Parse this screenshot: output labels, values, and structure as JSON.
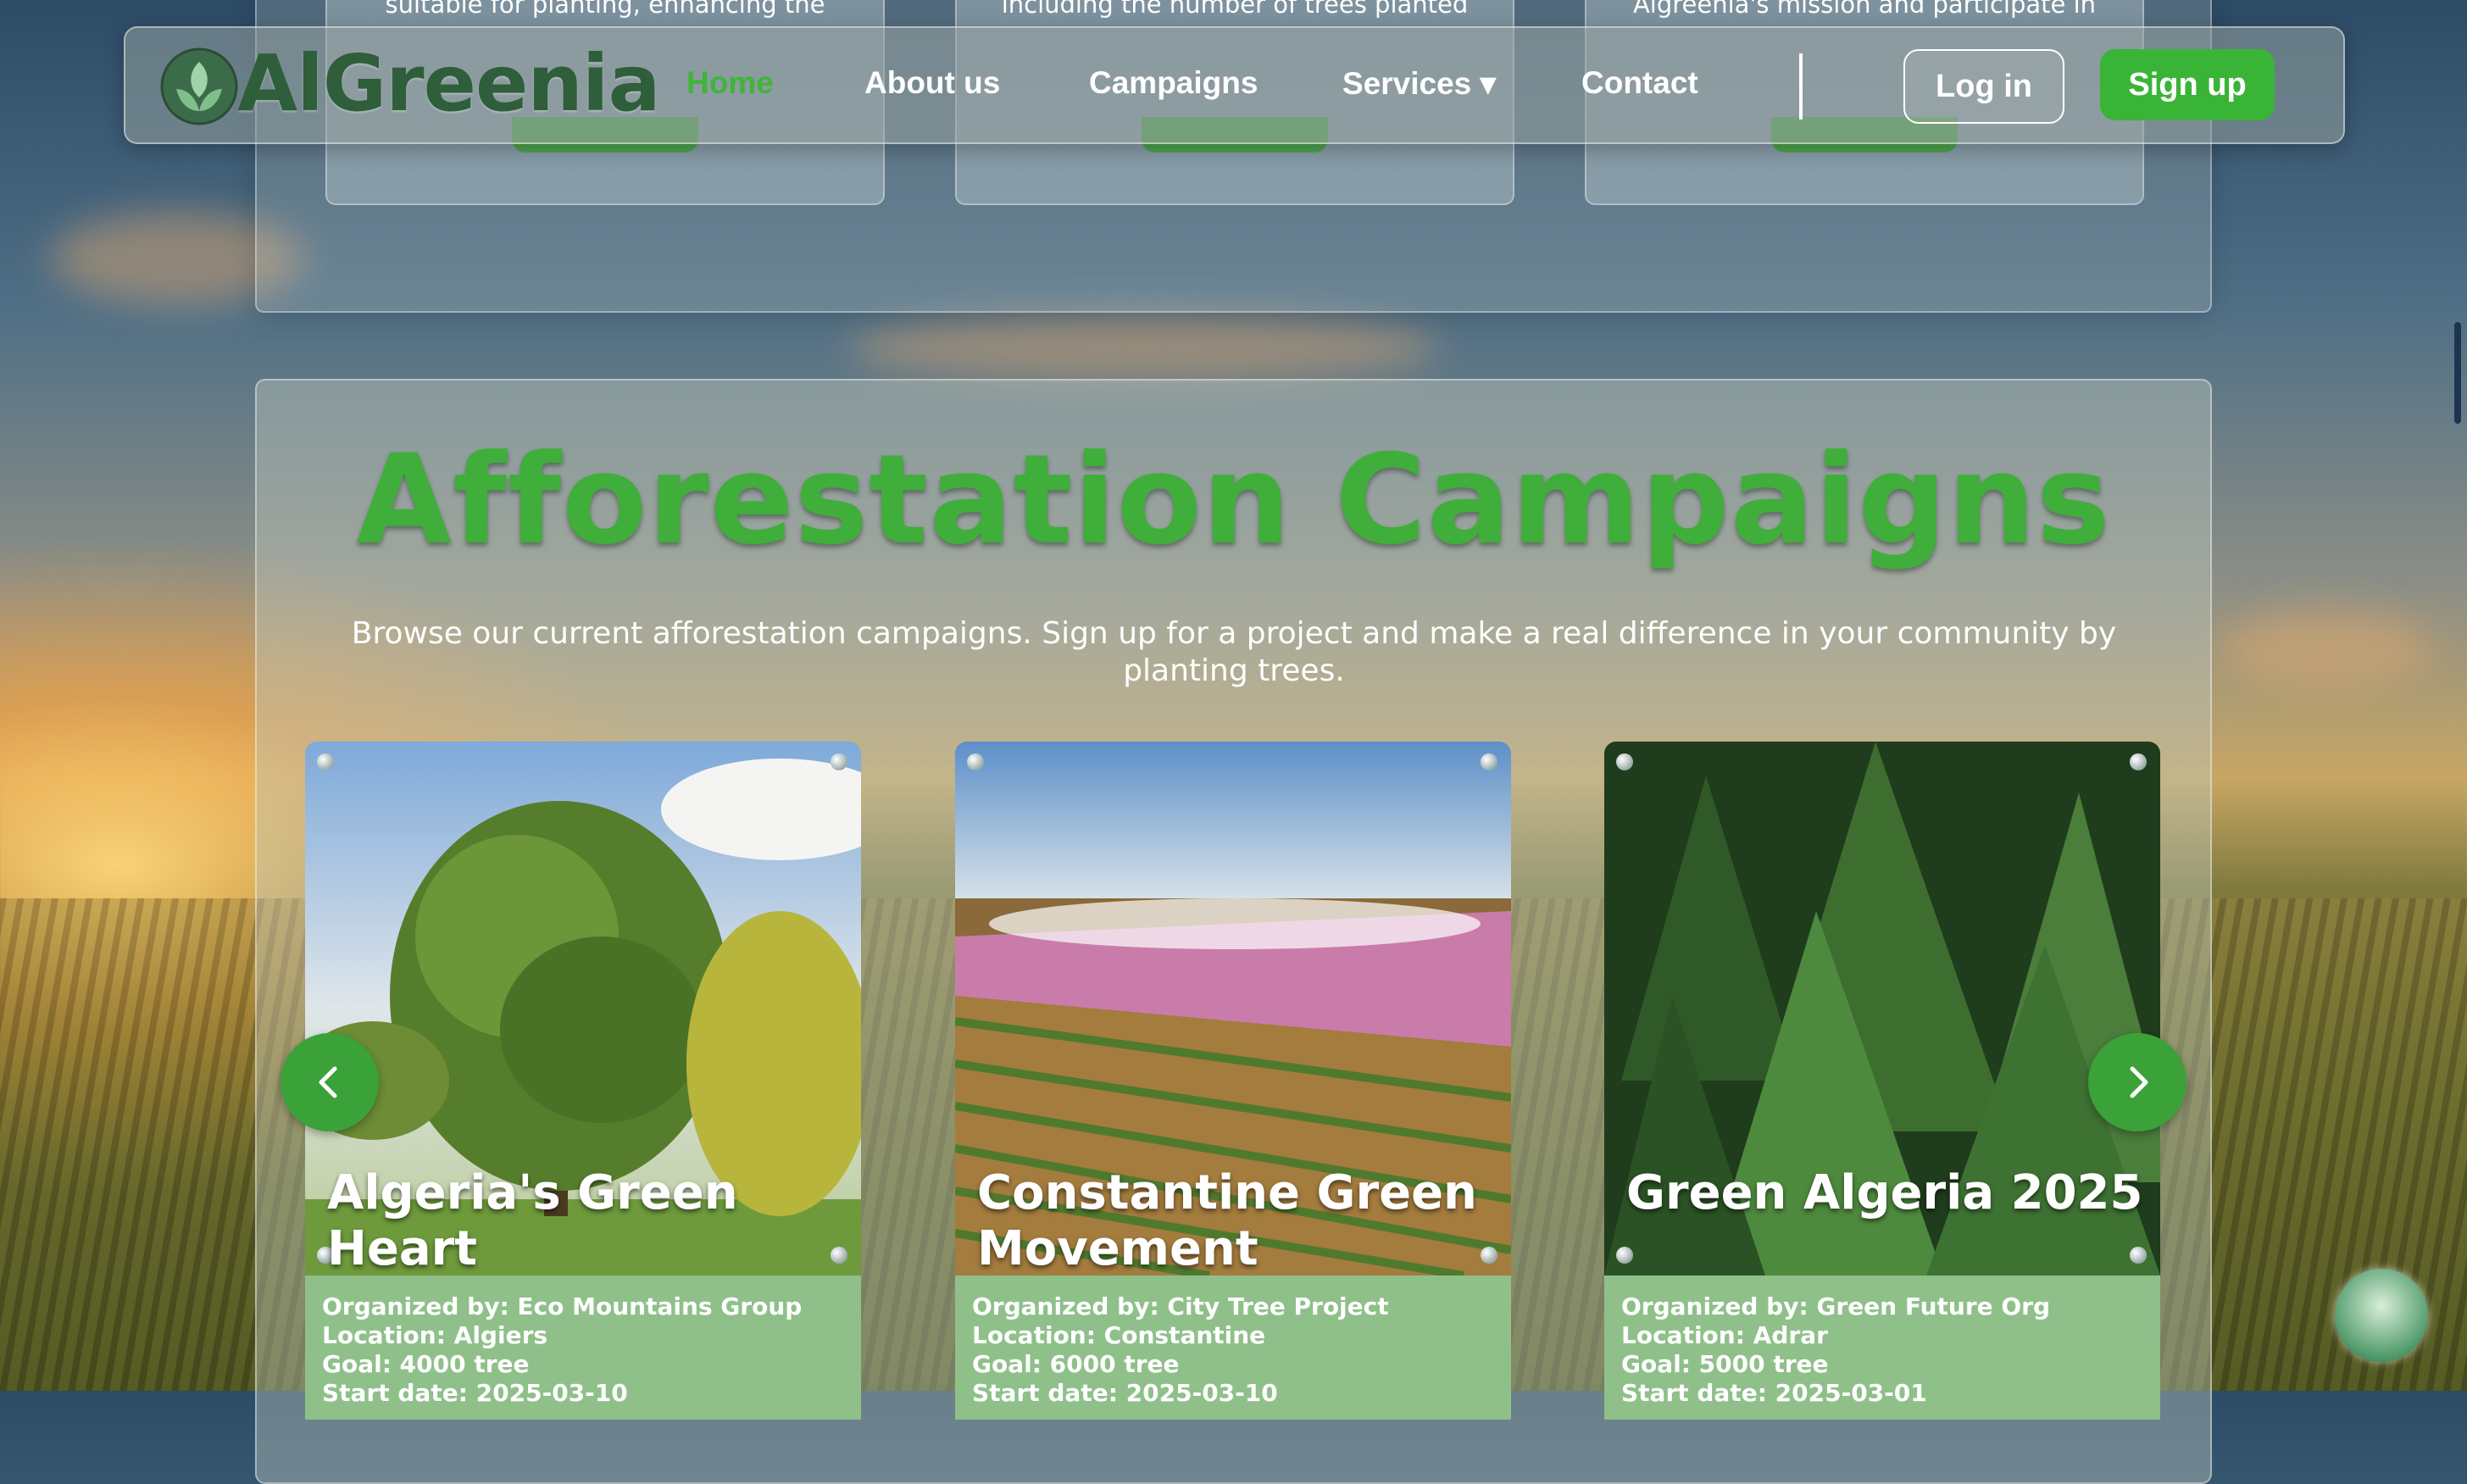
{
  "nav": {
    "logo_text": "AlGreenia",
    "links": [
      "Home",
      "About us",
      "Campaigns",
      "Services ▾",
      "Contact"
    ],
    "login": "Log in",
    "signup": "Sign up"
  },
  "top_cards": [
    {
      "text": "suitable for planting, enhancing the"
    },
    {
      "text": "including the number of trees planted"
    },
    {
      "text": "Algreenia's mission and participate in"
    }
  ],
  "section": {
    "title": "Afforestation Campaigns",
    "description": "Browse our current afforestation campaigns. Sign up for a project and make a real difference in your community by planting trees."
  },
  "campaigns": [
    {
      "title": "Algeria's Green Heart",
      "organizer": "Organized by: Eco Mountains Group",
      "location": "Location: Algiers",
      "goal": "Goal: 4000 tree",
      "start": "Start date: 2025-03-10"
    },
    {
      "title": "Constantine Green Movement",
      "organizer": "Organized by: City Tree Project",
      "location": "Location: Constantine",
      "goal": "Goal: 6000 tree",
      "start": "Start date: 2025-03-10"
    },
    {
      "title": "Green Algeria 2025",
      "organizer": "Organized by: Green Future Org",
      "location": "Location: Adrar",
      "goal": "Goal: 5000 tree",
      "start": "Start date: 2025-03-01"
    }
  ],
  "icons": {
    "prev": "chevron-left-icon",
    "next": "chevron-right-icon",
    "corner": "algreenia-badge-icon"
  },
  "colors": {
    "accent": "#3ab437",
    "title_green": "#3fae3a",
    "info_bg": "#8fc08a"
  }
}
